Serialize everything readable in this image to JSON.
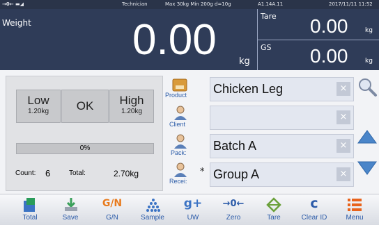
{
  "status": {
    "icons_text": "→0← ▬◢",
    "user": "Technician",
    "specs": "Max 30kg  Min 200g  d=10g",
    "version": "A1.14A.11",
    "datetime": "2017/11/11  11:52"
  },
  "display": {
    "weight_label": "Weight",
    "weight_value": "0.00",
    "weight_unit": "kg",
    "tare_label": "Tare",
    "tare_value": "0.00",
    "tare_unit": "kg",
    "gs_label": "GS",
    "gs_value": "0.00",
    "gs_unit": "kg"
  },
  "checkweigh": {
    "low_label": "Low",
    "low_value": "1.20kg",
    "ok_label": "OK",
    "high_label": "High",
    "high_value": "1.20kg",
    "progress_text": "0%",
    "progress": 0,
    "count_label": "Count:",
    "count_value": "6",
    "total_label": "Total:",
    "total_value": "2.70kg"
  },
  "fields": {
    "product": {
      "label": "Product",
      "value": "Chicken Leg",
      "clear": "×"
    },
    "client": {
      "label": "Client",
      "value": "",
      "clear": "×"
    },
    "pack": {
      "label": "Pack:",
      "value": "Batch A",
      "clear": "×"
    },
    "receiver": {
      "label": "Recei:",
      "marker": "*",
      "value": "Group A",
      "clear": "×"
    }
  },
  "toolbar": {
    "total": "Total",
    "save": "Save",
    "gn_icon": "G/N",
    "gn": "G/N",
    "sample": "Sample",
    "uw_icon": "g+",
    "uw": "UW",
    "zero_icon": "→0←",
    "zero": "Zero",
    "tare": "Tare",
    "clear_icon": "c",
    "clear_id": "Clear ID",
    "menu": "Menu"
  },
  "colors": {
    "display_bg": "#2f3c58",
    "status_bg": "#2a3449",
    "accent_blue": "#2a5aa8",
    "gn_orange": "#e87a1c",
    "menu_orange": "#e8631c",
    "tare_green": "#6aa03a"
  }
}
